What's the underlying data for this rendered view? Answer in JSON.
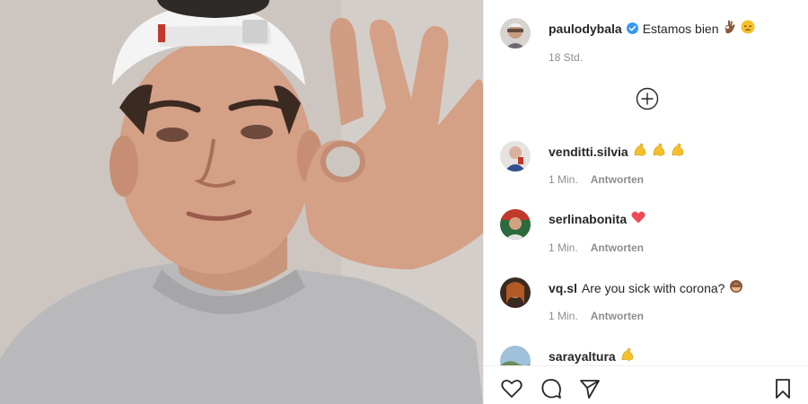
{
  "post": {
    "username": "paulodybala",
    "caption": "Estamos bien",
    "time": "18 Std.",
    "verified": true
  },
  "comments": [
    {
      "username": "venditti.silvia",
      "text": "",
      "time": "1 Min.",
      "reply_label": "Antworten"
    },
    {
      "username": "serlinabonita",
      "text": "",
      "time": "1 Min.",
      "reply_label": "Antworten"
    },
    {
      "username": "vq.sl",
      "text": "Are you sick with corona?",
      "time": "1 Min.",
      "reply_label": "Antworten"
    },
    {
      "username": "sarayaltura",
      "text": "",
      "time": "",
      "reply_label": ""
    }
  ],
  "icons": {
    "load_more": "plus-circle-icon",
    "like": "heart-icon",
    "comment": "speech-bubble-icon",
    "share": "paper-plane-icon",
    "save": "bookmark-icon"
  },
  "colors": {
    "text": "#262626",
    "meta": "#8e8e8e",
    "verified": "#3897f0",
    "heart": "#ed4956",
    "emoji_yellow": "#f5c02a"
  }
}
